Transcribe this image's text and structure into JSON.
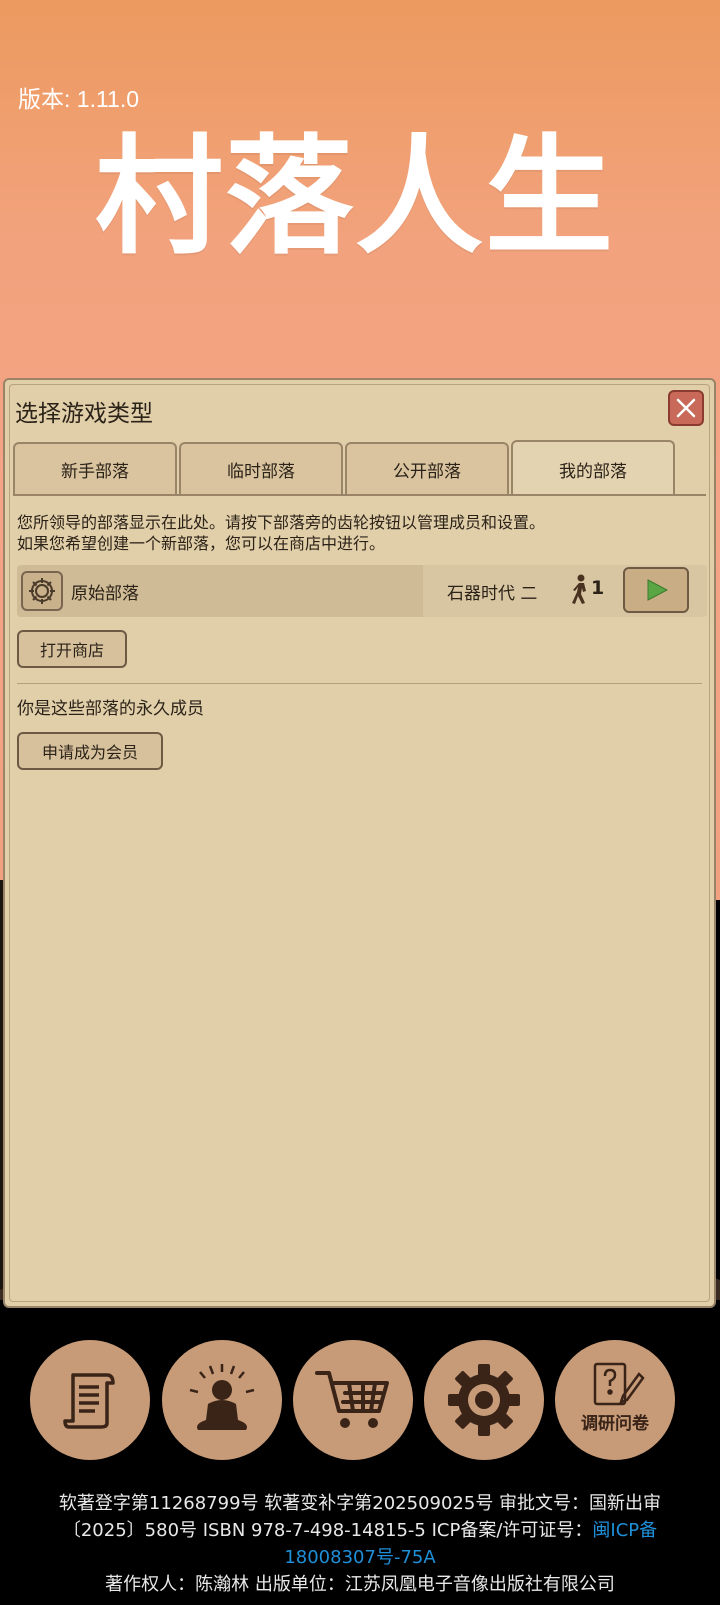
{
  "header": {
    "version": "版本: 1.11.0",
    "logo_text": "村落人生"
  },
  "dialog": {
    "title": "选择游戏类型",
    "tabs": [
      {
        "label": "新手部落"
      },
      {
        "label": "临时部落"
      },
      {
        "label": "公开部落"
      },
      {
        "label": "我的部落",
        "active": true
      }
    ],
    "description_line1": "您所领导的部落显示在此处。请按下部落旁的齿轮按钮以管理成员和设置。",
    "description_line2": "如果您希望创建一个新部落，您可以在商店中进行。",
    "tribe": {
      "name": "原始部落",
      "era": "石器时代 二",
      "members": "1"
    },
    "open_shop_label": "打开商店",
    "member_text": "你是这些部落的永久成员",
    "apply_member_label": "申请成为会员"
  },
  "bottom_nav": [
    {
      "icon": "scroll-icon"
    },
    {
      "icon": "meditation-icon"
    },
    {
      "icon": "cart-icon"
    },
    {
      "icon": "gear-icon"
    },
    {
      "icon": "survey-icon",
      "label": "调研问卷"
    }
  ],
  "footer": {
    "line1": "软著登字第11268799号 软著变补字第202509025号 审批文号：国新出审",
    "line2_text": "〔2025〕580号 ISBN 978-7-498-14815-5 ICP备案/许可证号：",
    "line2_link": "闽ICP备",
    "line3_link": "18008307号-75A",
    "line4": "著作权人：陈瀚林 出版单位：江苏凤凰电子音像出版社有限公司"
  },
  "colors": {
    "sky_top": "#ec9a5f",
    "sky_bottom": "#f3a080",
    "panel_bg": "#e1cfaa",
    "nav_button": "#c79b78",
    "close_button": "#c9695a",
    "link": "#1f8fd8"
  }
}
